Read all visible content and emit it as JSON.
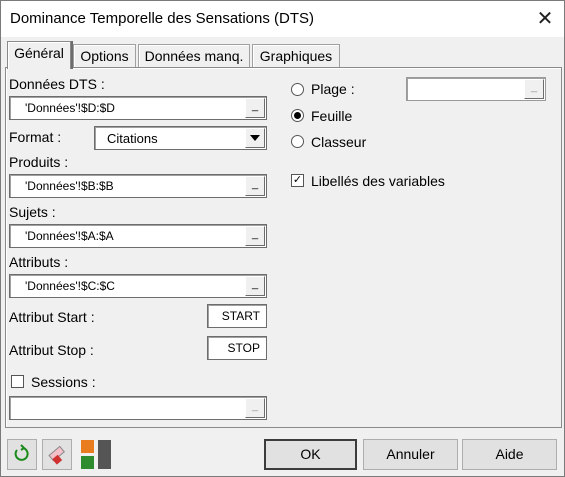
{
  "window": {
    "title": "Dominance Temporelle des Sensations (DTS)",
    "close_glyph": "✕"
  },
  "tabs": [
    {
      "label": "Général"
    },
    {
      "label": "Options"
    },
    {
      "label": "Données manq."
    },
    {
      "label": "Graphiques"
    }
  ],
  "general": {
    "donnees_dts": {
      "label": "Données DTS :",
      "value": "'Données'!$D:$D"
    },
    "format": {
      "label": "Format :",
      "value": "Citations"
    },
    "produits": {
      "label": "Produits :",
      "value": "'Données'!$B:$B"
    },
    "sujets": {
      "label": "Sujets :",
      "value": "'Données'!$A:$A"
    },
    "attributs": {
      "label": "Attributs :",
      "value": "'Données'!$C:$C"
    },
    "attribut_start": {
      "label": "Attribut Start :",
      "value": "START"
    },
    "attribut_stop": {
      "label": "Attribut Stop :",
      "value": "STOP"
    },
    "sessions": {
      "label": "Sessions :",
      "checked": false,
      "value": ""
    },
    "output": {
      "plage": {
        "label": "Plage :",
        "selected": false
      },
      "feuille": {
        "label": "Feuille",
        "selected": true
      },
      "classeur": {
        "label": "Classeur",
        "selected": false
      },
      "plage_value": ""
    },
    "libelles": {
      "label": "Libellés des variables",
      "checked": true
    }
  },
  "ref_button_glyph": "_",
  "check_glyph": "✓",
  "footer": {
    "ok": "OK",
    "annuler": "Annuler",
    "aide": "Aide"
  }
}
